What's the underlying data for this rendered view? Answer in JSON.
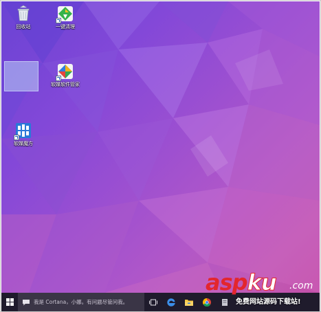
{
  "desktop": {
    "icons": [
      {
        "label": "回收站",
        "icon": "recycle-bin-icon"
      },
      {
        "label": "一键清理",
        "icon": "broom-cleanup-icon"
      },
      {
        "label": "软媒软件管家",
        "icon": "software-manager-icon"
      },
      {
        "label": "软媒魔方",
        "icon": "rubiks-cube-app-icon"
      }
    ]
  },
  "taskbar": {
    "start_icon": "windows-logo-icon",
    "search_placeholder": "我是 Cortana，小娜。有问题尽管问我。",
    "pinned": [
      {
        "icon": "task-view-icon"
      },
      {
        "icon": "edge-browser-icon"
      },
      {
        "icon": "file-explorer-icon"
      },
      {
        "icon": "chrome-browser-icon"
      },
      {
        "icon": "app-icon"
      }
    ]
  },
  "watermark": {
    "brand_red": "asp",
    "brand_white": "ku",
    "domain": ".com",
    "tagline": "免费网站源码下载站!"
  },
  "colors": {
    "taskbar": "#1f1b2c",
    "search_box": "#3a3546",
    "watermark_red": "#e3262d",
    "wallpaper_start": "#6a43d4",
    "wallpaper_end": "#c24fa8"
  }
}
